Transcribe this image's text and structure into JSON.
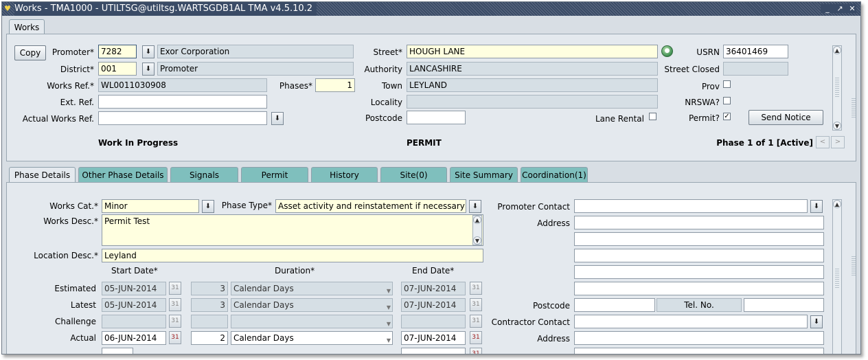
{
  "window": {
    "title": "Works - TMA1000 - UTILTSG@utiltsg.WARTSGDB1AL TMA v4.5.10.2",
    "controls": [
      "minimize-icon",
      "restore-icon",
      "close-icon"
    ]
  },
  "works_tab": "Works",
  "header": {
    "copy_label": "Copy",
    "promoter_label": "Promoter*",
    "promoter_code": "7282",
    "promoter_name": "Exor Corporation",
    "district_label": "District*",
    "district_code": "001",
    "district_name": "Promoter",
    "works_ref_label": "Works Ref.*",
    "works_ref": "WL0011030908",
    "phases_label": "Phases*",
    "phases": "1",
    "ext_ref_label": "Ext. Ref.",
    "ext_ref": "",
    "actual_works_ref_label": "Actual Works Ref.",
    "actual_works_ref": "",
    "street_label": "Street*",
    "street": "HOUGH LANE",
    "authority_label": "Authority",
    "authority": "LANCASHIRE",
    "town_label": "Town",
    "town": "LEYLAND",
    "locality_label": "Locality",
    "locality": "",
    "postcode_label": "Postcode",
    "postcode": "",
    "lane_rental_label": "Lane Rental",
    "usrn_label": "USRN",
    "usrn": "36401469",
    "street_closed_label": "Street Closed",
    "street_closed": "",
    "prov_label": "Prov",
    "nrswa_label": "NRSWA?",
    "permit_q_label": "Permit?",
    "permit_checked_mark": "✓",
    "send_notice_label": "Send Notice",
    "status": "Work In Progress",
    "works_type": "PERMIT",
    "phase_status": "Phase 1 of 1 [Active]",
    "prev_label": "<",
    "next_label": ">"
  },
  "tabs": [
    {
      "label": "Phase Details",
      "active": true
    },
    {
      "label": "Other Phase Details",
      "active": false
    },
    {
      "label": "Signals",
      "active": false
    },
    {
      "label": "Permit",
      "active": false
    },
    {
      "label": "History",
      "active": false
    },
    {
      "label": "Site(0)",
      "active": false
    },
    {
      "label": "Site Summary",
      "active": false
    },
    {
      "label": "Coordination(1)",
      "active": false
    }
  ],
  "phase": {
    "works_cat_label": "Works Cat.*",
    "works_cat": "Minor",
    "phase_type_label": "Phase Type*",
    "phase_type": "Asset activity and reinstatement if necessary",
    "works_desc_label": "Works Desc.*",
    "works_desc": "Permit Test",
    "location_desc_label": "Location Desc.*",
    "location_desc": "Leyland",
    "start_date_header": "Start Date*",
    "duration_header": "Duration*",
    "end_date_header": "End Date*",
    "rows": [
      {
        "label": "Estimated",
        "start": "05-JUN-2014",
        "duration": "3",
        "unit": "Calendar Days",
        "end": "07-JUN-2014"
      },
      {
        "label": "Latest",
        "start": "05-JUN-2014",
        "duration": "3",
        "unit": "Calendar Days",
        "end": "07-JUN-2014"
      },
      {
        "label": "Challenge",
        "start": "",
        "duration": "",
        "unit": "",
        "end": ""
      },
      {
        "label": "Actual",
        "start": "06-JUN-2014",
        "duration": "2",
        "unit": "Calendar Days",
        "end": "07-JUN-2014"
      }
    ],
    "promoter_contact_label": "Promoter Contact",
    "promoter_contact": "",
    "address_label": "Address",
    "postcode_label": "Postcode",
    "postcode": "",
    "tel_label": "Tel. No.",
    "tel": "",
    "contractor_contact_label": "Contractor Contact",
    "contractor_contact": "",
    "contractor_address_label": "Address"
  },
  "icons": {
    "lov": "⬇",
    "calendar": "📅",
    "globe": "🌐",
    "scroll_up": "▲",
    "scroll_down": "▼",
    "select_arrow": "▼"
  }
}
